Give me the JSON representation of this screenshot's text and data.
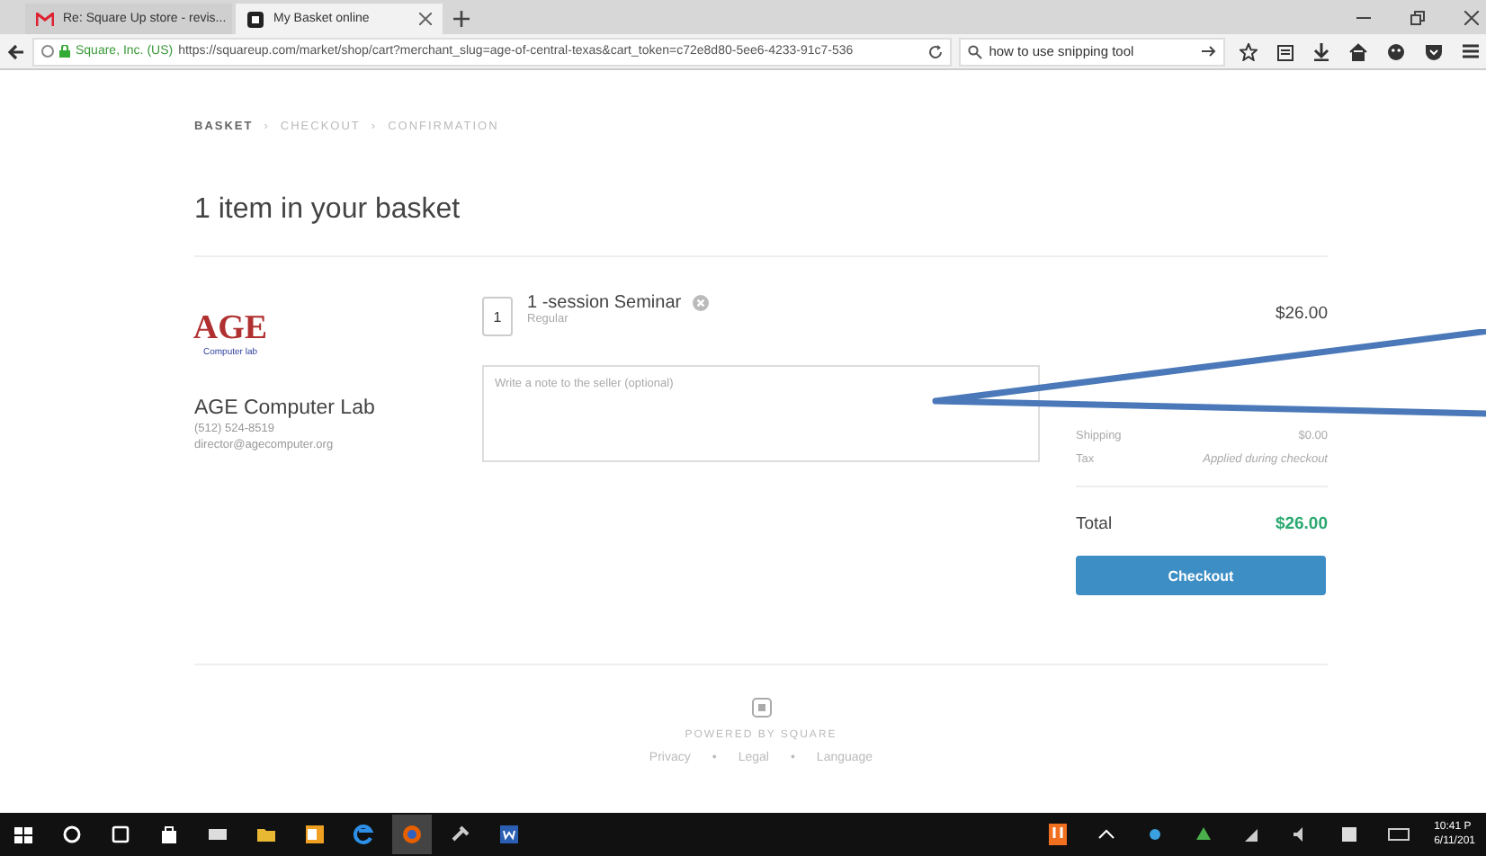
{
  "browser": {
    "tabs": [
      {
        "title": "Re: Square Up store - revis...",
        "selected": false
      },
      {
        "title": "My Basket online",
        "selected": true
      }
    ],
    "site_identity": "Square, Inc. (US)",
    "url": "https://squareup.com/market/shop/cart?merchant_slug=age-of-central-texas&cart_token=c72e8d80-5ee6-4233-91c7-536",
    "search": "how to use snipping tool"
  },
  "breadcrumb": {
    "separator": "›",
    "steps": [
      {
        "label": "BASKET",
        "selected": true
      },
      {
        "label": "CHECKOUT",
        "selected": false
      },
      {
        "label": "CONFIRMATION",
        "selected": false
      }
    ]
  },
  "heading": "1 item in your basket",
  "merchant": {
    "logo": {
      "title": "AGE",
      "subtitle": "Computer lab"
    },
    "name": "AGE Computer Lab",
    "phone": "(512) 524-8519",
    "email": "director@agecomputer.org"
  },
  "item": {
    "quantity": "1",
    "name": "1 -session Seminar",
    "variant": "Regular",
    "price": "$26.00",
    "note_placeholder": "Write a note to the seller (optional)"
  },
  "summary": {
    "rows": [
      {
        "label": "Shipping",
        "value": "$0.00",
        "kind": "amount"
      },
      {
        "label": "Tax",
        "value": "Applied during checkout",
        "kind": "note"
      }
    ],
    "total_label": "Total",
    "total_value": "$26.00",
    "checkout": "Checkout"
  },
  "footer": {
    "powered": "POWERED BY SQUARE",
    "separator": "•",
    "links": [
      "Privacy",
      "Legal",
      "Language"
    ]
  },
  "taskbar": {
    "time": "10:41 P",
    "date": "6/11/201"
  }
}
